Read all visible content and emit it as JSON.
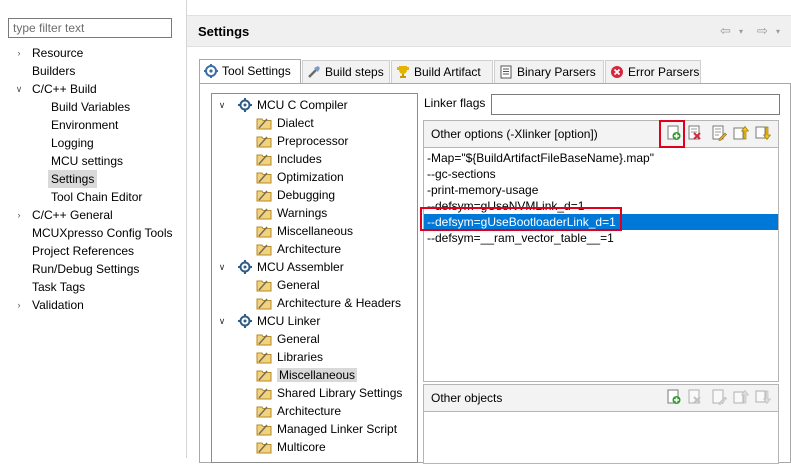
{
  "left_nav": {
    "filter_placeholder": "type filter text",
    "items": [
      {
        "label": "Resource",
        "expandable": true,
        "expanded": false
      },
      {
        "label": "Builders",
        "expandable": false
      },
      {
        "label": "C/C++ Build",
        "expandable": true,
        "expanded": true
      },
      {
        "label": "Build Variables",
        "child": true
      },
      {
        "label": "Environment",
        "child": true
      },
      {
        "label": "Logging",
        "child": true
      },
      {
        "label": "MCU settings",
        "child": true
      },
      {
        "label": "Settings",
        "child": true,
        "selected": true
      },
      {
        "label": "Tool Chain Editor",
        "child": true
      },
      {
        "label": "C/C++ General",
        "expandable": true,
        "expanded": false
      },
      {
        "label": "MCUXpresso Config Tools",
        "expandable": false
      },
      {
        "label": "Project References",
        "expandable": false
      },
      {
        "label": "Run/Debug Settings",
        "expandable": false
      },
      {
        "label": "Task Tags",
        "expandable": false
      },
      {
        "label": "Validation",
        "expandable": true,
        "expanded": false
      }
    ]
  },
  "header": {
    "title": "Settings"
  },
  "tabs": [
    {
      "label": "Tool Settings",
      "icon": "tool-settings-icon",
      "active": true
    },
    {
      "label": "Build steps",
      "icon": "build-steps-icon"
    },
    {
      "label": "Build Artifact",
      "icon": "build-artifact-icon"
    },
    {
      "label": "Binary Parsers",
      "icon": "binary-parsers-icon"
    },
    {
      "label": "Error Parsers",
      "icon": "error-parsers-icon"
    }
  ],
  "tool_tree": [
    {
      "label": "MCU C Compiler",
      "kind": "tool",
      "expanded": true
    },
    {
      "label": "Dialect",
      "kind": "option"
    },
    {
      "label": "Preprocessor",
      "kind": "option"
    },
    {
      "label": "Includes",
      "kind": "option"
    },
    {
      "label": "Optimization",
      "kind": "option"
    },
    {
      "label": "Debugging",
      "kind": "option"
    },
    {
      "label": "Warnings",
      "kind": "option"
    },
    {
      "label": "Miscellaneous",
      "kind": "option"
    },
    {
      "label": "Architecture",
      "kind": "option"
    },
    {
      "label": "MCU Assembler",
      "kind": "tool",
      "expanded": true
    },
    {
      "label": "General",
      "kind": "option"
    },
    {
      "label": "Architecture & Headers",
      "kind": "option"
    },
    {
      "label": "MCU Linker",
      "kind": "tool",
      "expanded": true
    },
    {
      "label": "General",
      "kind": "option"
    },
    {
      "label": "Libraries",
      "kind": "option"
    },
    {
      "label": "Miscellaneous",
      "kind": "option",
      "selected": true
    },
    {
      "label": "Shared Library Settings",
      "kind": "option"
    },
    {
      "label": "Architecture",
      "kind": "option"
    },
    {
      "label": "Managed Linker Script",
      "kind": "option"
    },
    {
      "label": "Multicore",
      "kind": "option"
    }
  ],
  "linker_flags": {
    "label": "Linker flags",
    "value": ""
  },
  "other_options": {
    "title": "Other options (-Xlinker [option])",
    "tools": [
      "add-icon",
      "delete-icon",
      "edit-icon",
      "move-up-icon",
      "move-down-icon"
    ],
    "items": [
      "-Map=\"${BuildArtifactFileBaseName}.map\"",
      "--gc-sections",
      "-print-memory-usage",
      "--defsym=gUseNVMLink_d=1",
      "--defsym=gUseBootloaderLink_d=1",
      "--defsym=__ram_vector_table__=1"
    ],
    "selected_index": 4
  },
  "other_objects": {
    "title": "Other objects",
    "tools": [
      "add-icon",
      "delete-icon",
      "edit-icon",
      "move-up-icon",
      "move-down-icon"
    ]
  },
  "colors": {
    "selection_blue": "#0078d7",
    "highlight_red": "#e0001b"
  }
}
